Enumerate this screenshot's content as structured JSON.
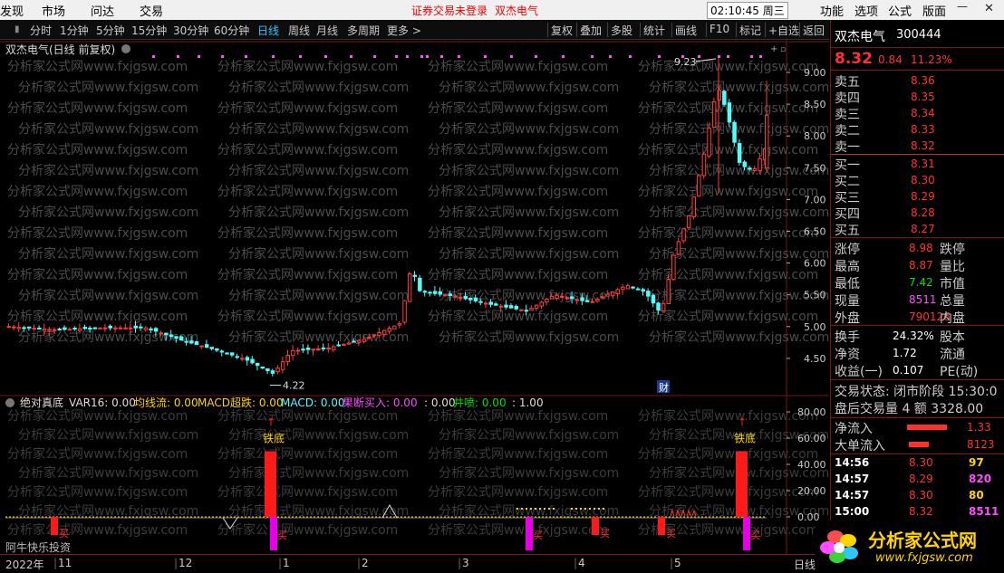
{
  "menubar": {
    "items": [
      "发现",
      "市场",
      "问达",
      "交易"
    ],
    "login_notice": "证券交易未登录",
    "stock_name": "双杰电气",
    "clock": "02:10:45 周三",
    "right_items": [
      "功能",
      "选项",
      "公式",
      "版面"
    ]
  },
  "toolbar": {
    "periods": [
      "分时",
      "1分钟",
      "5分钟",
      "15分钟",
      "30分钟",
      "60分钟",
      "日线",
      "周线",
      "月线",
      "多周期",
      "更多 >"
    ],
    "active": "日线",
    "tools": [
      "复权",
      "叠加",
      "多股",
      "统计",
      "画线",
      "F10",
      "标记",
      "+自选",
      "返回"
    ]
  },
  "chart": {
    "title": "双杰电气(日线 前复权)",
    "watermark": "分析家公式网www.fxjgsw.com",
    "annotations": {
      "high": "9.23",
      "low": "4.22",
      "marker": "财"
    },
    "y_ticks": [
      "9.00",
      "8.50",
      "8.00",
      "7.50",
      "7.00",
      "6.50",
      "6.00",
      "5.50",
      "5.00",
      "4.50"
    ],
    "up_color": "#ff3c3c",
    "down_color": "#54fcfc"
  },
  "indicator": {
    "name": "绝对真底",
    "parts": [
      {
        "t": "VAR16: 0.00",
        "c": "#dddddd"
      },
      {
        "t": "均线流: 0.00",
        "c": "#ffd400"
      },
      {
        "t": "MACD超跌: 0.00",
        "c": "#ffd400"
      },
      {
        "t": "MACD: 0.00",
        "c": "#54fcfc"
      },
      {
        "t": "果断买入: 0.00",
        "c": "#ff4cff"
      },
      {
        "t": ": 0.00",
        "c": "#dddddd"
      },
      {
        "t": "井喷: 0.00",
        "c": "#00e000"
      },
      {
        "t": ": 1.00",
        "c": "#dddddd"
      }
    ],
    "y_ticks": [
      "80.00",
      "60.00",
      "40.00",
      "20.00",
      "0.00"
    ],
    "label_bottom": "铁底",
    "label_buy": "买"
  },
  "bottombar": {
    "source": "阿牛快乐投资",
    "year": "2022年",
    "months": [
      "11",
      "12",
      "1",
      "2",
      "3",
      "4",
      "5"
    ],
    "period": "日线"
  },
  "quote": {
    "name": "双杰电气",
    "code": "300444",
    "price": "8.32",
    "change": "0.84",
    "pct": "11.23%",
    "asks": [
      {
        "label": "卖五",
        "price": "8.36"
      },
      {
        "label": "卖四",
        "price": "8.35"
      },
      {
        "label": "卖三",
        "price": "8.34"
      },
      {
        "label": "卖二",
        "price": "8.33"
      },
      {
        "label": "卖一",
        "price": "8.32"
      }
    ],
    "bids": [
      {
        "label": "买一",
        "price": "8.31"
      },
      {
        "label": "买二",
        "price": "8.30"
      },
      {
        "label": "买三",
        "price": "8.29"
      },
      {
        "label": "买四",
        "price": "8.28"
      },
      {
        "label": "买五",
        "price": "8.27"
      }
    ],
    "stats": [
      {
        "l": "涨停",
        "v": "8.98",
        "c": "red",
        "r": "跌停"
      },
      {
        "l": "最高",
        "v": "8.87",
        "c": "red",
        "r": "量比"
      },
      {
        "l": "最低",
        "v": "7.42",
        "c": "grn",
        "r": "市值"
      },
      {
        "l": "现量",
        "v": "8511",
        "c": "mag",
        "r": "总量"
      },
      {
        "l": "外盘",
        "v": "790126",
        "c": "red",
        "r": "内盘"
      }
    ],
    "stats2": [
      {
        "l": "换手",
        "v": "24.32%",
        "r": "股本"
      },
      {
        "l": "净资",
        "v": "1.72",
        "r": "流通"
      },
      {
        "l": "收益(一)",
        "v": "0.107",
        "r": "PE(动)"
      }
    ],
    "status": "交易状态: 闭市阶段 15:30:0",
    "after": "盘后交易量 4 额 3328.00",
    "flows": [
      {
        "l": "净流入",
        "v": "1.33"
      },
      {
        "l": "大单流入",
        "v": "8123"
      }
    ],
    "ticks": [
      {
        "t": "14:56",
        "p": "8.30",
        "v": "97"
      },
      {
        "t": "14:57",
        "p": "8.29",
        "v": "820"
      },
      {
        "t": "14:57",
        "p": "8.30",
        "v": "80"
      },
      {
        "t": "15:00",
        "p": "8.32",
        "v": "8511"
      }
    ]
  },
  "logo": {
    "text": "分析家公式网",
    "url": "www.fxjgsw.com"
  }
}
